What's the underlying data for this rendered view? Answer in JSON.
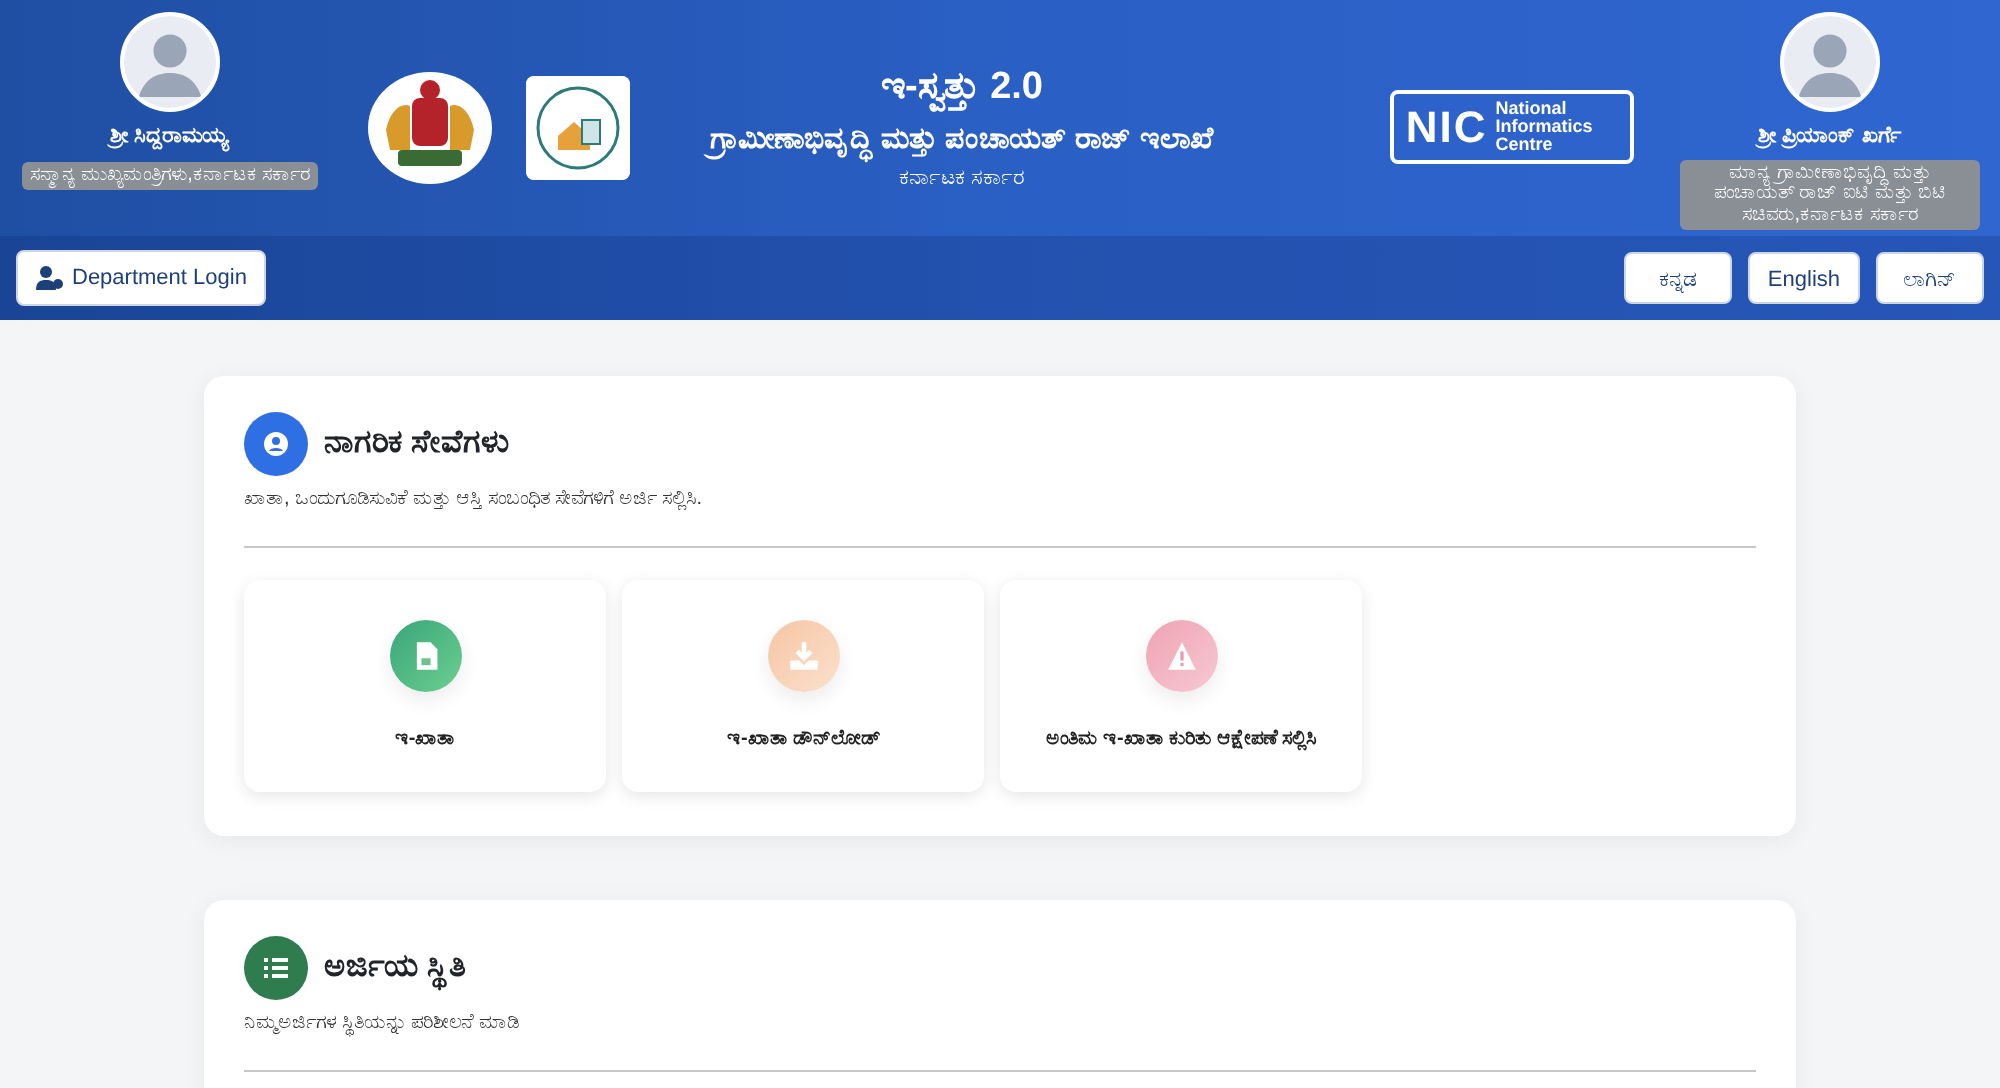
{
  "header": {
    "left_person": {
      "name": "ಶ್ರೀ ಸಿದ್ದರಾಮಯ್ಯ",
      "designation": "ಸನ್ಮಾನ್ಯ ಮುಖ್ಯಮಂತ್ರಿಗಳು,ಕರ್ನಾಟಕ ಸರ್ಕಾರ"
    },
    "title": "ಇ-ಸ್ವತ್ತು 2.0",
    "department": "ಗ್ರಾಮೀಣಾಭಿವೃದ್ಧಿ ಮತ್ತು ಪಂಚಾಯತ್ ರಾಜ್ ಇಲಾಖೆ",
    "government": "ಕರ್ನಾಟಕ ಸರ್ಕಾರ",
    "nic_logo": {
      "mark": "NIC",
      "text": "National Informatics Centre"
    },
    "right_person": {
      "name": "ಶ್ರೀ ಪ್ರಿಯಾಂಕ್ ಖರ್ಗೆ",
      "designation": "ಮಾನ್ಯ ಗ್ರಾಮೀಣಾಭಿವೃದ್ಧಿ ಮತ್ತು ಪಂಚಾಯತ್ ರಾಜ್ ಐಟಿ ಮತ್ತು ಬಿಟಿ ಸಚಿವರು,ಕರ್ನಾಟಕ ಸರ್ಕಾರ"
    }
  },
  "toolbar": {
    "department_login": "Department Login",
    "buttons": [
      "ಕನ್ನಡ",
      "English",
      "ಲಾಗಿನ್"
    ]
  },
  "sections": [
    {
      "kind": "citizen",
      "title": "ನಾಗರಿಕ ಸೇವೆಗಳು",
      "subtitle": "ಖಾತಾ, ಒಂದುಗೂಡಿಸುವಿಕೆ ಮತ್ತು ಆಸ್ತಿ ಸಂಬಂಧಿತ ಸೇವೆಗಳಿಗೆ ಅರ್ಜಿ ಸಲ್ಲಿಸಿ.",
      "services": [
        {
          "kind": "document",
          "label": "ಇ-ಖಾತಾ"
        },
        {
          "kind": "download",
          "label": "ಇ-ಖಾತಾ ಡೌನ್‌ಲೋಡ್"
        },
        {
          "kind": "warning",
          "label": "ಅಂತಿಮ ಇ-ಖಾತಾ ಕುರಿತು ಆಕ್ಷೇಪಣೆ ಸಲ್ಲಿಸಿ"
        }
      ]
    },
    {
      "kind": "status",
      "title": "ಅರ್ಜಿಯ ಸ್ಥಿತಿ",
      "subtitle": "ನಿಮ್ಮಅರ್ಜಿಗಳ ಸ್ಥಿತಿಯನ್ನು ಪರಿಶೀಲನೆ ಮಾಡಿ"
    }
  ]
}
